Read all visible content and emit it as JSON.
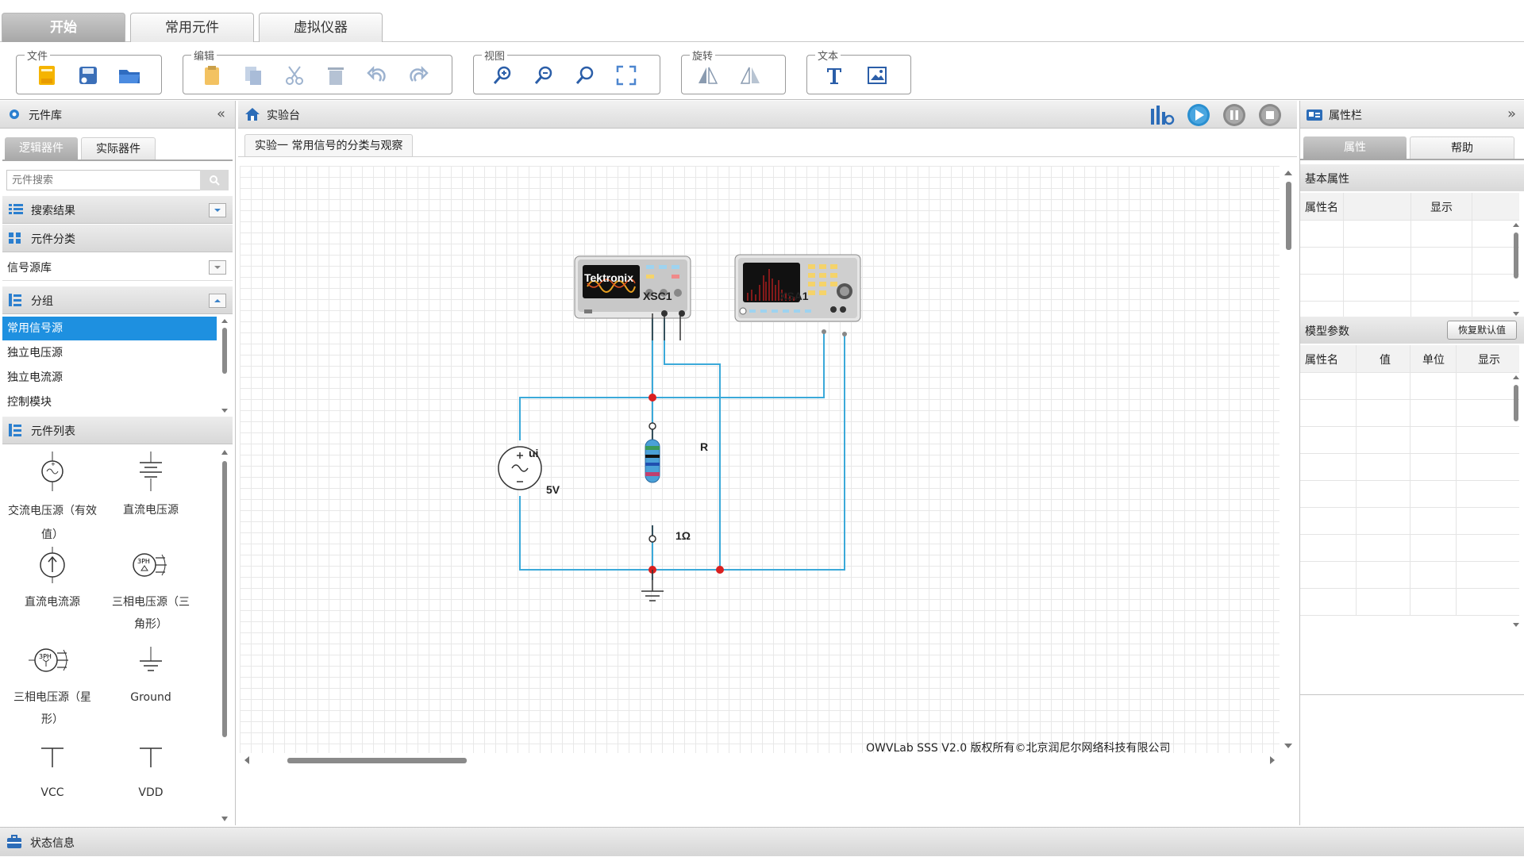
{
  "top_tabs": [
    "开始",
    "常用元件",
    "虚拟仪器"
  ],
  "ribbon": {
    "groups": [
      {
        "label": "文件",
        "icons": [
          "new-file-icon",
          "save-icon",
          "open-folder-icon"
        ]
      },
      {
        "label": "编辑",
        "icons": [
          "paste-icon",
          "copy-icon",
          "cut-icon",
          "delete-icon",
          "undo-icon",
          "redo-icon"
        ]
      },
      {
        "label": "视图",
        "icons": [
          "zoom-in-icon",
          "zoom-out-icon",
          "zoom-reset-icon",
          "fit-screen-icon"
        ]
      },
      {
        "label": "旋转",
        "icons": [
          "flip-horizontal-icon",
          "flip-vertical-icon"
        ]
      },
      {
        "label": "文本",
        "icons": [
          "text-icon",
          "image-icon"
        ]
      }
    ]
  },
  "left_panel": {
    "title": "元件库",
    "tabs": [
      "逻辑器件",
      "实际器件"
    ],
    "search_placeholder": "元件搜索",
    "search_results_label": "搜索结果",
    "category_label": "元件分类",
    "category_value": "信号源库",
    "group_label": "分组",
    "groups": [
      "常用信号源",
      "独立电压源",
      "独立电流源",
      "控制模块"
    ],
    "selected_group": 0,
    "component_list_label": "元件列表",
    "components": [
      {
        "label": "交流电压源（有效值）",
        "icon": "ac-voltage-source-icon"
      },
      {
        "label": "直流电压源",
        "icon": "dc-voltage-source-icon"
      },
      {
        "label": "直流电流源",
        "icon": "dc-current-source-icon"
      },
      {
        "label": "三相电压源（三角形）",
        "icon": "three-phase-delta-icon"
      },
      {
        "label": "三相电压源（星形）",
        "icon": "three-phase-star-icon"
      },
      {
        "label": "Ground",
        "icon": "ground-icon"
      },
      {
        "label": "VCC",
        "icon": "vcc-icon"
      },
      {
        "label": "VDD",
        "icon": "vdd-icon"
      }
    ]
  },
  "workbench": {
    "title": "实验台",
    "doc_tab": "实验一 常用信号的分类与观察",
    "controls": [
      "chart-settings-icon",
      "play-icon",
      "pause-icon",
      "stop-icon"
    ],
    "circuit": {
      "oscilloscope_label": "XSC1",
      "oscilloscope_brand": "Tektronix",
      "analyzer_label": "XSA1",
      "source_name": "ui",
      "source_value": "5V",
      "resistor_name": "R",
      "resistor_value": "1Ω"
    },
    "copyright": "OWVLab SSS V2.0 版权所有©北京润尼尔网络科技有限公司"
  },
  "right_panel": {
    "title": "属性栏",
    "tabs": [
      "属性",
      "帮助"
    ],
    "basic_props_label": "基本属性",
    "basic_cols": [
      "属性名",
      "显示"
    ],
    "model_params_label": "模型参数",
    "restore_button": "恢复默认值",
    "model_cols": [
      "属性名",
      "值",
      "单位",
      "显示"
    ]
  },
  "status_bar": {
    "label": "状态信息"
  },
  "colors": {
    "wire": "#3ba9d9",
    "node": "#d92020",
    "selected": "#1e90e0",
    "play": "#2a8fd0"
  }
}
